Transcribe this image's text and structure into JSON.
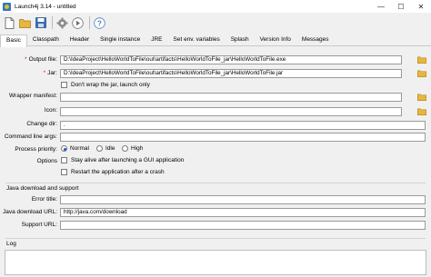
{
  "window": {
    "title": "Launch4j 3.14 - untitled",
    "minimize": "—",
    "maximize": "☐",
    "close": "✕"
  },
  "toolbar": {
    "new_icon": "new-file-icon",
    "open_icon": "open-folder-icon",
    "save_icon": "save-icon",
    "settings_icon": "gear-icon",
    "run_icon": "play-icon",
    "help_icon": "help-icon"
  },
  "tabs": [
    "Basic",
    "Classpath",
    "Header",
    "Single instance",
    "JRE",
    "Set env. variables",
    "Splash",
    "Version Info",
    "Messages"
  ],
  "basic": {
    "output_label": "Output file:",
    "output_value": "D:\\IdeaProject\\HelloWorldToFile\\out\\artifacts\\HelloWorldToFile_jar\\HelloWorldToFile.exe",
    "jar_label": "Jar:",
    "jar_value": "D:\\IdeaProject\\HelloWorldToFile\\out\\artifacts\\HelloWorldToFile_jar\\HelloWorldToFile.jar",
    "dont_wrap_label": "Don't wrap the jar, launch only",
    "wrapper_manifest_label": "Wrapper manifest:",
    "icon_label": "Icon:",
    "change_dir_label": "Change dir:",
    "change_dir_value": ".",
    "cmd_args_label": "Command line args:",
    "priority_label": "Process priority:",
    "priority_normal": "Normal",
    "priority_idle": "Idle",
    "priority_high": "High",
    "options_label": "Options",
    "stay_alive_label": "Stay alive after launching a GUI application",
    "restart_label": "Restart the application after a crash"
  },
  "java_download": {
    "section_title": "Java download and support",
    "error_title_label": "Error title:",
    "download_url_label": "Java download URL:",
    "download_url_value": "http://java.com/download",
    "support_url_label": "Support URL:"
  },
  "log": {
    "section_title": "Log"
  },
  "colors": {
    "required": "#e01b1b",
    "radio_selected": "#1a56c7",
    "folder": "#e9b63b"
  }
}
